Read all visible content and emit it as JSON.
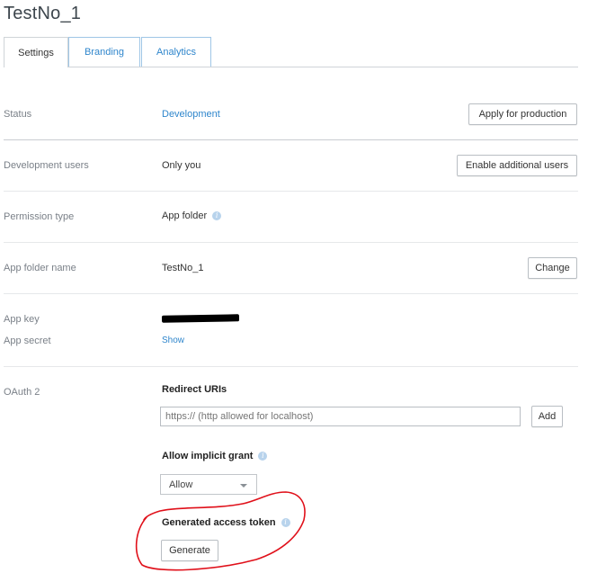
{
  "app_title": "TestNo_1",
  "tabs": [
    "Settings",
    "Branding",
    "Analytics"
  ],
  "status": {
    "label": "Status",
    "value": "Development",
    "button": "Apply for production"
  },
  "dev_users": {
    "label": "Development users",
    "value": "Only you",
    "button": "Enable additional users"
  },
  "permission": {
    "label": "Permission type",
    "value": "App folder"
  },
  "folder": {
    "label": "App folder name",
    "value": "TestNo_1",
    "button": "Change"
  },
  "app_key": {
    "label": "App key"
  },
  "app_secret": {
    "label": "App secret",
    "value": "Show"
  },
  "oauth": {
    "label": "OAuth 2",
    "redirect_heading": "Redirect URIs",
    "redirect_placeholder": "https:// (http allowed for localhost)",
    "add_button": "Add",
    "implicit_heading": "Allow implicit grant",
    "implicit_value": "Allow",
    "token_heading": "Generated access token",
    "generate_button": "Generate"
  },
  "colors": {
    "link": "#2f86cc",
    "annotation": "#e0101a"
  },
  "icons": {
    "info": "info-icon",
    "caret": "chevron-down-icon"
  }
}
